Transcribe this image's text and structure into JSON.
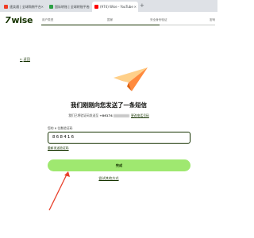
{
  "browser": {
    "tabs": [
      {
        "title": "速卖通 | 全球购物平台",
        "color": "#f03c24"
      },
      {
        "title": "国际转账 | 全球转账平台",
        "color": "#2ca044"
      },
      {
        "title": "(974) Wise - YouTube",
        "color": "#ff0000"
      }
    ],
    "new_tab": "+"
  },
  "brand": {
    "logo_flag": "7",
    "logo_text": "wise"
  },
  "progress": {
    "steps": [
      "用户类型",
      "国家",
      "安全身份验证",
      "密码"
    ],
    "completed_fraction": 0.68
  },
  "back_link": {
    "arrow": "←",
    "label": "返回"
  },
  "title": "我们刚刚向您发送了一条短信",
  "subtitle": {
    "prefix": "我们已将验证码发送至",
    "phone": "+86174",
    "link": "更改电话号码"
  },
  "code_field": {
    "label": "您的 6 位数验证码",
    "value": "868416"
  },
  "resend_link": "重新发送验证码",
  "done_button": "完成",
  "other_method_link": "尝试其他方式",
  "colors": {
    "brand": "#163300",
    "accent": "#9fe870",
    "annotation": "#e8412c"
  }
}
